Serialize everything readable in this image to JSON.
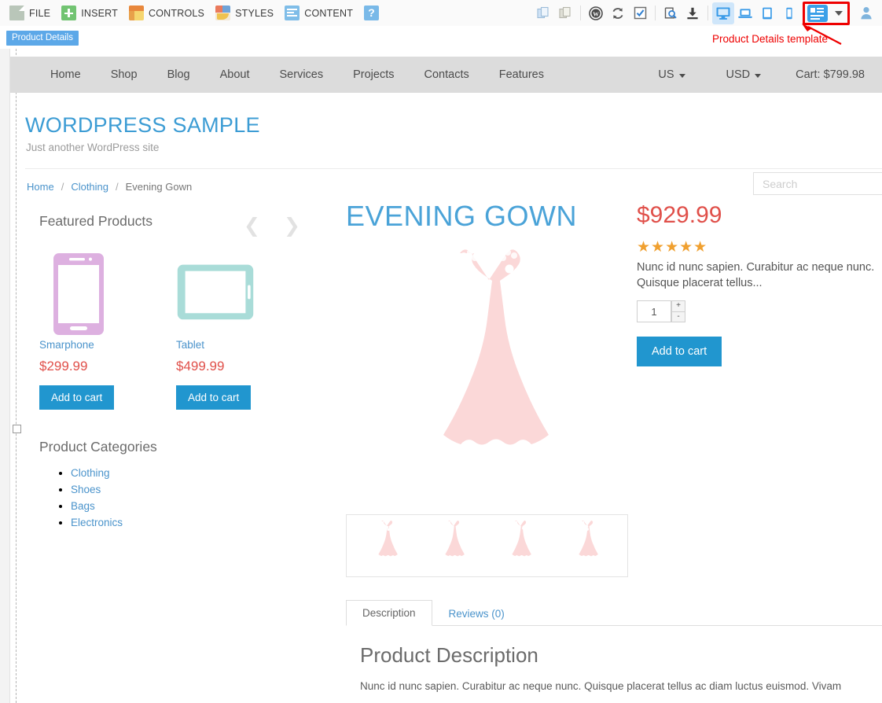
{
  "toolbar": {
    "menus": [
      {
        "label": "FILE",
        "icon": "file-icon"
      },
      {
        "label": "INSERT",
        "icon": "insert-icon"
      },
      {
        "label": "CONTROLS",
        "icon": "controls-icon"
      },
      {
        "label": "STYLES",
        "icon": "styles-icon"
      },
      {
        "label": "CONTENT",
        "icon": "content-icon"
      },
      {
        "label": "?",
        "icon": "help-icon"
      }
    ],
    "right_icons": [
      "copy-icon",
      "paste-icon",
      "wordpress-icon",
      "refresh-icon",
      "checkbox-icon",
      "preview-search-icon",
      "download-icon",
      "desktop-icon",
      "laptop-icon",
      "tablet-icon",
      "mobile-icon",
      "template-icon"
    ],
    "annotation": "Product Details template",
    "active_page_tab": "Product Details",
    "accent_highlight": "#ee0000",
    "accent_blue": "#3aa0e8"
  },
  "site": {
    "nav_links": [
      "Home",
      "Shop",
      "Blog",
      "About",
      "Services",
      "Projects",
      "Contacts",
      "Features"
    ],
    "region": "US",
    "currency": "USD",
    "cart_label": "Cart:",
    "cart_total": "$799.98",
    "title": "WORDPRESS SAMPLE",
    "tagline": "Just another WordPress site",
    "search_placeholder": "Search",
    "search_value": ""
  },
  "breadcrumb": {
    "items": [
      "Home",
      "Clothing",
      "Evening Gown"
    ],
    "separator": "/"
  },
  "sidebar": {
    "featured_title": "Featured Products",
    "carousel_prev": "❮",
    "carousel_next": "❯",
    "products": [
      {
        "name": "Smarphone",
        "price": "$299.99",
        "cta": "Add to cart",
        "image": "smartphone-icon",
        "color": "#ddb0e0"
      },
      {
        "name": "Tablet",
        "price": "$499.99",
        "cta": "Add to cart",
        "image": "tablet-icon",
        "color": "#a9dcd8"
      }
    ],
    "categories_title": "Product Categories",
    "categories": [
      "Clothing",
      "Shoes",
      "Bags",
      "Electronics"
    ]
  },
  "product": {
    "title": "EVENING GOWN",
    "price": "$929.99",
    "rating_stars": "★★★★★",
    "rating_value": 5,
    "short_description": "Nunc id nunc sapien. Curabitur ac neque nunc. Quisque placerat tellus...",
    "quantity": "1",
    "qty_increment": "+",
    "qty_decrement": "-",
    "add_to_cart": "Add to cart",
    "image": "evening-gown-image",
    "thumbnails": [
      "gown-thumb-1",
      "gown-thumb-2",
      "gown-thumb-3",
      "gown-thumb-4"
    ],
    "image_color": "#fbd8d8"
  },
  "tabs": {
    "items": [
      {
        "label": "Description",
        "active": true
      },
      {
        "label": "Reviews (0)",
        "active": false
      }
    ],
    "description_heading": "Product Description",
    "description_text": "Nunc id nunc sapien. Curabitur ac neque nunc. Quisque placerat tellus ac diam luctus euismod. Vivam"
  },
  "colors": {
    "brand_blue": "#4aa3d8",
    "price_red": "#e0504a",
    "button_blue": "#2196cf",
    "star_orange": "#f0a030",
    "nav_bg": "#dcdcdc"
  }
}
